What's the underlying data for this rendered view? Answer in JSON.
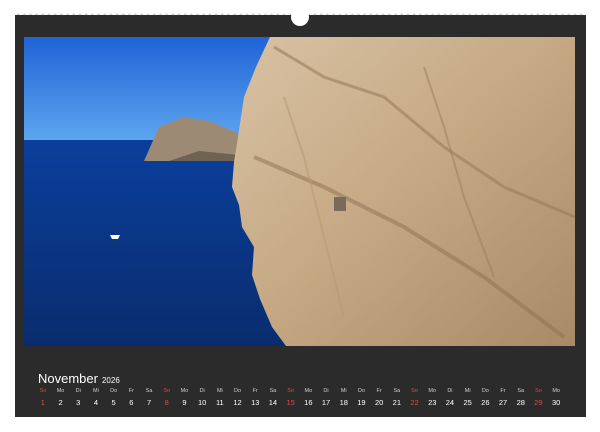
{
  "calendar": {
    "month": "November",
    "year": "2026",
    "weekdays": [
      "So",
      "Mo",
      "Di",
      "Mi",
      "Do",
      "Fr",
      "Sa",
      "So",
      "Mo",
      "Di",
      "Mi",
      "Do",
      "Fr",
      "Sa",
      "So",
      "Mo",
      "Di",
      "Mi",
      "Do",
      "Fr",
      "Sa",
      "So",
      "Mo",
      "Di",
      "Mi",
      "Do",
      "Fr",
      "Sa",
      "So",
      "Mo"
    ],
    "days": [
      "1",
      "2",
      "3",
      "4",
      "5",
      "6",
      "7",
      "8",
      "9",
      "10",
      "11",
      "12",
      "13",
      "14",
      "15",
      "16",
      "17",
      "18",
      "19",
      "20",
      "21",
      "22",
      "23",
      "24",
      "25",
      "26",
      "27",
      "28",
      "29",
      "30"
    ],
    "sunday_color": "#e0483f"
  }
}
